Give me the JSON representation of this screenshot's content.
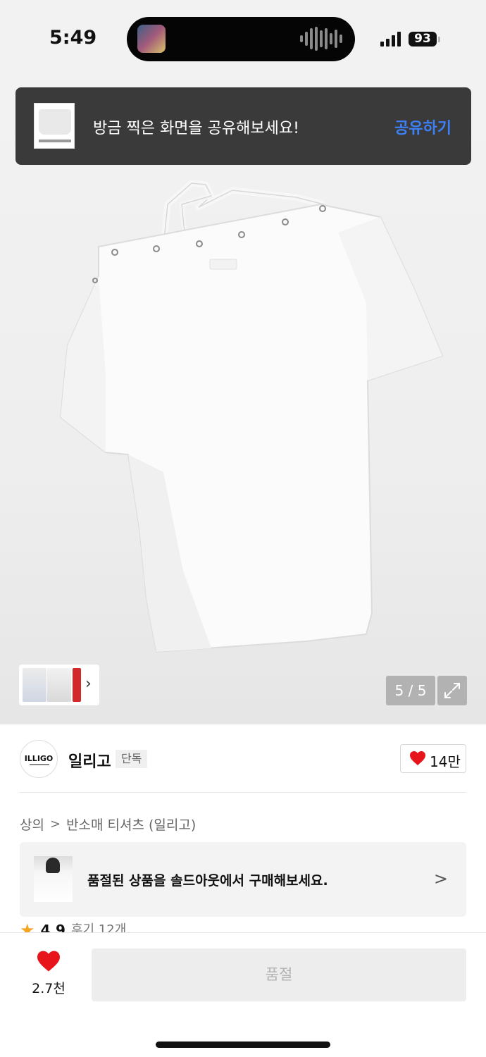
{
  "status_bar": {
    "time": "5:49",
    "battery": "93"
  },
  "gallery": {
    "counter": "5 / 5",
    "icons": {
      "expand": "expand-icon",
      "thumb_next": "chevron-right-icon"
    }
  },
  "share_toast": {
    "message": "방금 찍은 화면을 공유해보세요!",
    "action": "공유하기"
  },
  "brand": {
    "logo_text": "ILLIGO",
    "name": "일리고",
    "badge": "단독",
    "likes": "14만"
  },
  "breadcrumb": {
    "items": [
      "상의",
      "반소매 티셔츠 (일리고)"
    ],
    "separator": ">"
  },
  "soldout_banner": {
    "text": "품절된 상품을 솔드아웃에서 구매해보세요.",
    "chevron": ">"
  },
  "rating": {
    "star": "★",
    "score": "4.9",
    "reviews": "후기 12개"
  },
  "bottom_bar": {
    "wish_count": "2.7천",
    "buy_label": "품절"
  },
  "colors": {
    "toast_bg": "#3a3a3a",
    "toast_action": "#3d7ff5",
    "heart": "#e8141b",
    "star": "#f5a623",
    "disabled_btn": "#ededed"
  }
}
